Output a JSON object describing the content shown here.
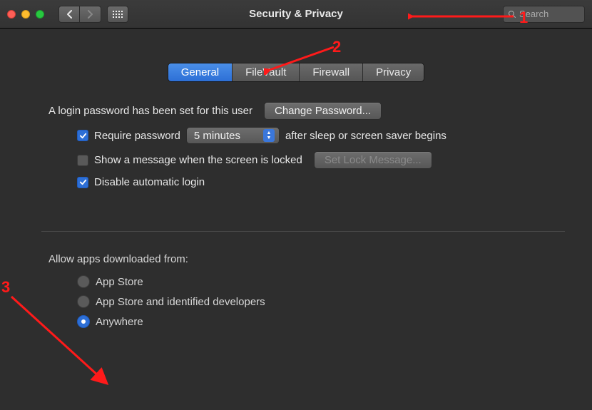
{
  "window": {
    "title": "Security & Privacy"
  },
  "search": {
    "placeholder": "Search"
  },
  "tabs": [
    {
      "label": "General",
      "active": true
    },
    {
      "label": "FileVault",
      "active": false
    },
    {
      "label": "Firewall",
      "active": false
    },
    {
      "label": "Privacy",
      "active": false
    }
  ],
  "general": {
    "login_password_text": "A login password has been set for this user",
    "change_password_btn": "Change Password...",
    "require_password_label": "Require password",
    "require_password_dropdown": "5 minutes",
    "require_password_suffix": "after sleep or screen saver begins",
    "show_message_label": "Show a message when the screen is locked",
    "set_lock_message_btn": "Set Lock Message...",
    "disable_auto_login_label": "Disable automatic login",
    "checkboxes": {
      "require_password": true,
      "show_message": false,
      "disable_auto_login": true
    }
  },
  "allow_apps": {
    "section_label": "Allow apps downloaded from:",
    "options": [
      {
        "label": "App Store",
        "selected": false
      },
      {
        "label": "App Store and identified developers",
        "selected": false
      },
      {
        "label": "Anywhere",
        "selected": true
      }
    ]
  },
  "annotations": {
    "one": "1",
    "two": "2",
    "three": "3"
  }
}
